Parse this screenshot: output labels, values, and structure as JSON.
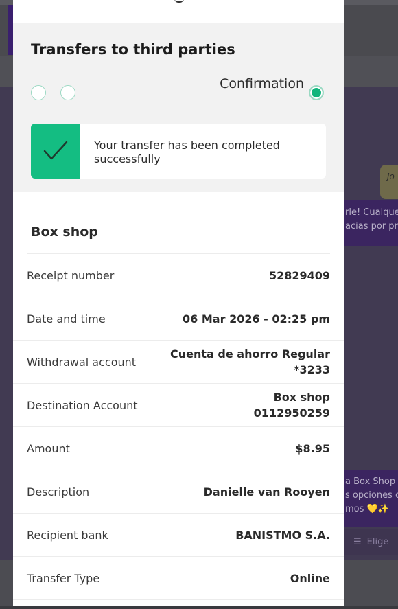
{
  "background": {
    "right_bubble_text": "Jo",
    "purple_bubble_line1": "rle! Cualque",
    "purple_bubble_line2": "acias por pre",
    "lower_bubble_line1": "a Box Shop",
    "lower_bubble_line2": "s opciones c",
    "lower_bubble_line3": "mos 💛✨",
    "elige_label": "Elige"
  },
  "modal": {
    "title": "Transfers to third parties",
    "stepper": {
      "current_step_label": "Confirmation",
      "steps": 3,
      "active_step": 3
    },
    "success_message": "Your transfer has been completed successfully",
    "merchant_name": "Box shop",
    "details": [
      {
        "label": "Receipt number",
        "value_line1": "52829409",
        "value_line2": ""
      },
      {
        "label": "Date and time",
        "value_line1": "06 Mar 2026 - 02:25 pm",
        "value_line2": ""
      },
      {
        "label": "Withdrawal account",
        "value_line1": "Cuenta de ahorro Regular",
        "value_line2": "*3233"
      },
      {
        "label": "Destination Account",
        "value_line1": "Box shop",
        "value_line2": "0112950259"
      },
      {
        "label": "Amount",
        "value_line1": "$8.95",
        "value_line2": ""
      },
      {
        "label": "Description",
        "value_line1": "Danielle van Rooyen",
        "value_line2": ""
      },
      {
        "label": "Recipient bank",
        "value_line1": "BANISTMO S.A.",
        "value_line2": ""
      },
      {
        "label": "Transfer Type",
        "value_line1": "Online",
        "value_line2": ""
      }
    ]
  },
  "colors": {
    "accent_green": "#14bd82",
    "stepper_line": "#9bd9c3",
    "overlay_bg": "#4a4a4f"
  },
  "icons": {
    "success": "checkmark-icon",
    "list": "list-icon"
  }
}
